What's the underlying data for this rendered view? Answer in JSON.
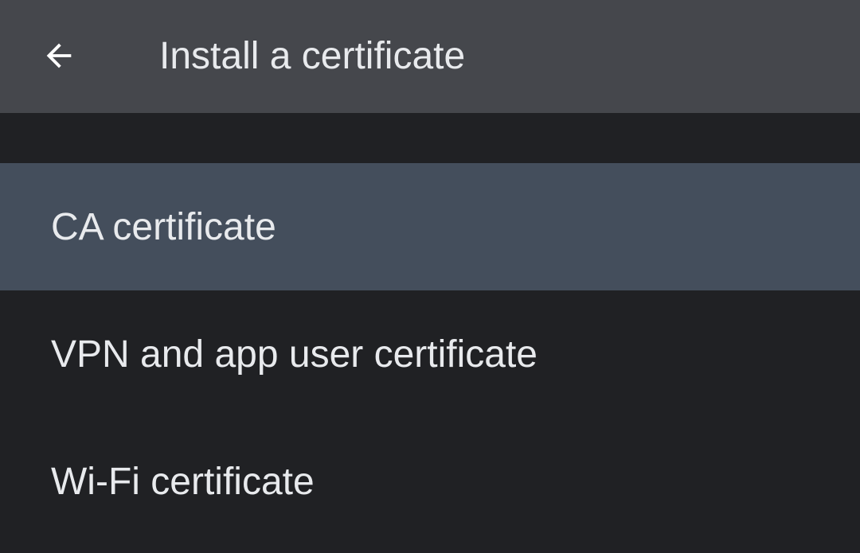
{
  "app_bar": {
    "back_icon": "arrow-back-icon",
    "title": "Install a certificate"
  },
  "list": {
    "items": [
      {
        "label": "CA certificate",
        "selected": true
      },
      {
        "label": "VPN and app user certificate",
        "selected": false
      },
      {
        "label": "Wi-Fi certificate",
        "selected": false
      }
    ]
  },
  "colors": {
    "app_bar_bg": "#45474c",
    "page_bg": "#202124",
    "selected_item_bg": "#444e5c",
    "text": "#e8eaed"
  }
}
